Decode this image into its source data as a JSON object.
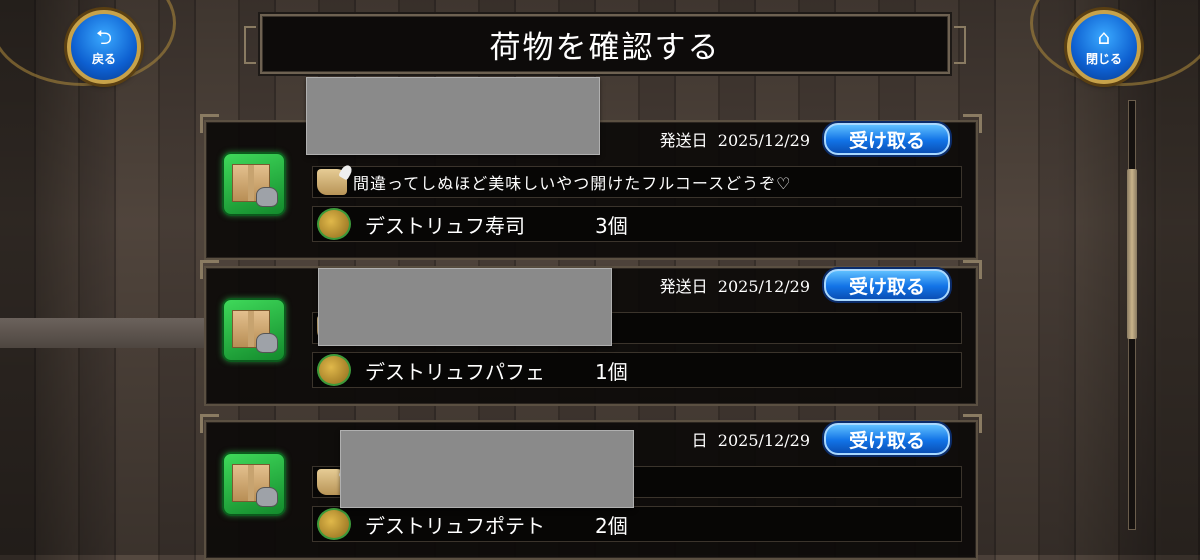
{
  "header": {
    "title": "荷物を確認する",
    "back_button": {
      "icon": "back-arrow-icon",
      "glyph": "⮌",
      "label": "戻る"
    },
    "close_button": {
      "icon": "home-icon",
      "glyph": "⌂",
      "label": "閉じる"
    }
  },
  "parcels": [
    {
      "date_label": "発送日",
      "date": "2025/12/29",
      "receive_label": "受け取る",
      "message": "間違ってしぬほど美味しいやつ開けたフルコースどうぞ♡",
      "item_name": "デストリュフ寿司",
      "item_count": "3個"
    },
    {
      "date_label": "発送日",
      "date": "2025/12/29",
      "receive_label": "受け取る",
      "message": "",
      "item_name": "デストリュフパフェ",
      "item_count": "1個"
    },
    {
      "date_label": "日",
      "date": "2025/12/29",
      "receive_label": "受け取る",
      "message": "",
      "item_name": "デストリュフポテト",
      "item_count": "2個"
    }
  ],
  "colors": {
    "receive_button": "#1273e6",
    "parcel_icon": "#2fbf4a",
    "panel_border": "#6e6252"
  }
}
